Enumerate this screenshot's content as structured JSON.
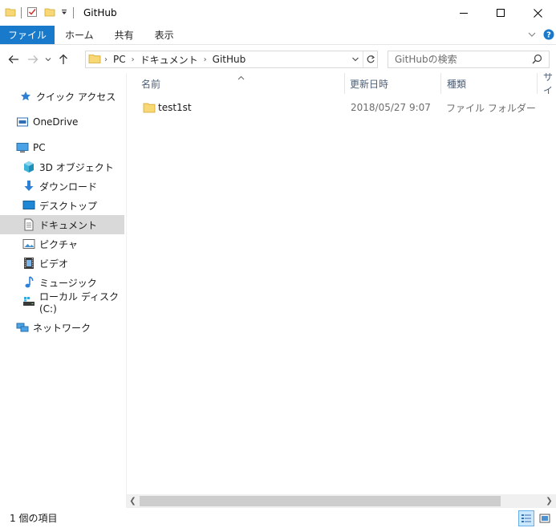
{
  "window": {
    "title": "GitHub"
  },
  "ribbon": {
    "tabs": [
      {
        "label": "ファイル"
      },
      {
        "label": "ホーム"
      },
      {
        "label": "共有"
      },
      {
        "label": "表示"
      }
    ]
  },
  "address": {
    "crumbs": [
      "PC",
      "ドキュメント",
      "GitHub"
    ]
  },
  "search": {
    "placeholder": "GitHubの検索"
  },
  "navpane": {
    "items": [
      {
        "label": "クイック アクセス",
        "icon": "star-icon"
      },
      {
        "label": "OneDrive",
        "icon": "onedrive-icon"
      },
      {
        "label": "PC",
        "icon": "pc-icon"
      },
      {
        "label": "3D オブジェクト",
        "icon": "3d-objects-icon"
      },
      {
        "label": "ダウンロード",
        "icon": "download-icon"
      },
      {
        "label": "デスクトップ",
        "icon": "desktop-icon"
      },
      {
        "label": "ドキュメント",
        "icon": "documents-icon"
      },
      {
        "label": "ピクチャ",
        "icon": "pictures-icon"
      },
      {
        "label": "ビデオ",
        "icon": "videos-icon"
      },
      {
        "label": "ミュージック",
        "icon": "music-icon"
      },
      {
        "label": "ローカル ディスク (C:)",
        "icon": "drive-icon"
      },
      {
        "label": "ネットワーク",
        "icon": "network-icon"
      }
    ],
    "selected": "ドキュメント"
  },
  "filelist": {
    "columns": [
      "名前",
      "更新日時",
      "種類",
      "サイ"
    ],
    "rows": [
      {
        "name": "test1st",
        "modified": "2018/05/27 9:07",
        "type": "ファイル フォルダー"
      }
    ]
  },
  "status": {
    "count": "1 個の項目"
  },
  "colors": {
    "accent": "#1979ca",
    "selected_bg": "#d9d9d9",
    "folder": "#f8d775"
  }
}
